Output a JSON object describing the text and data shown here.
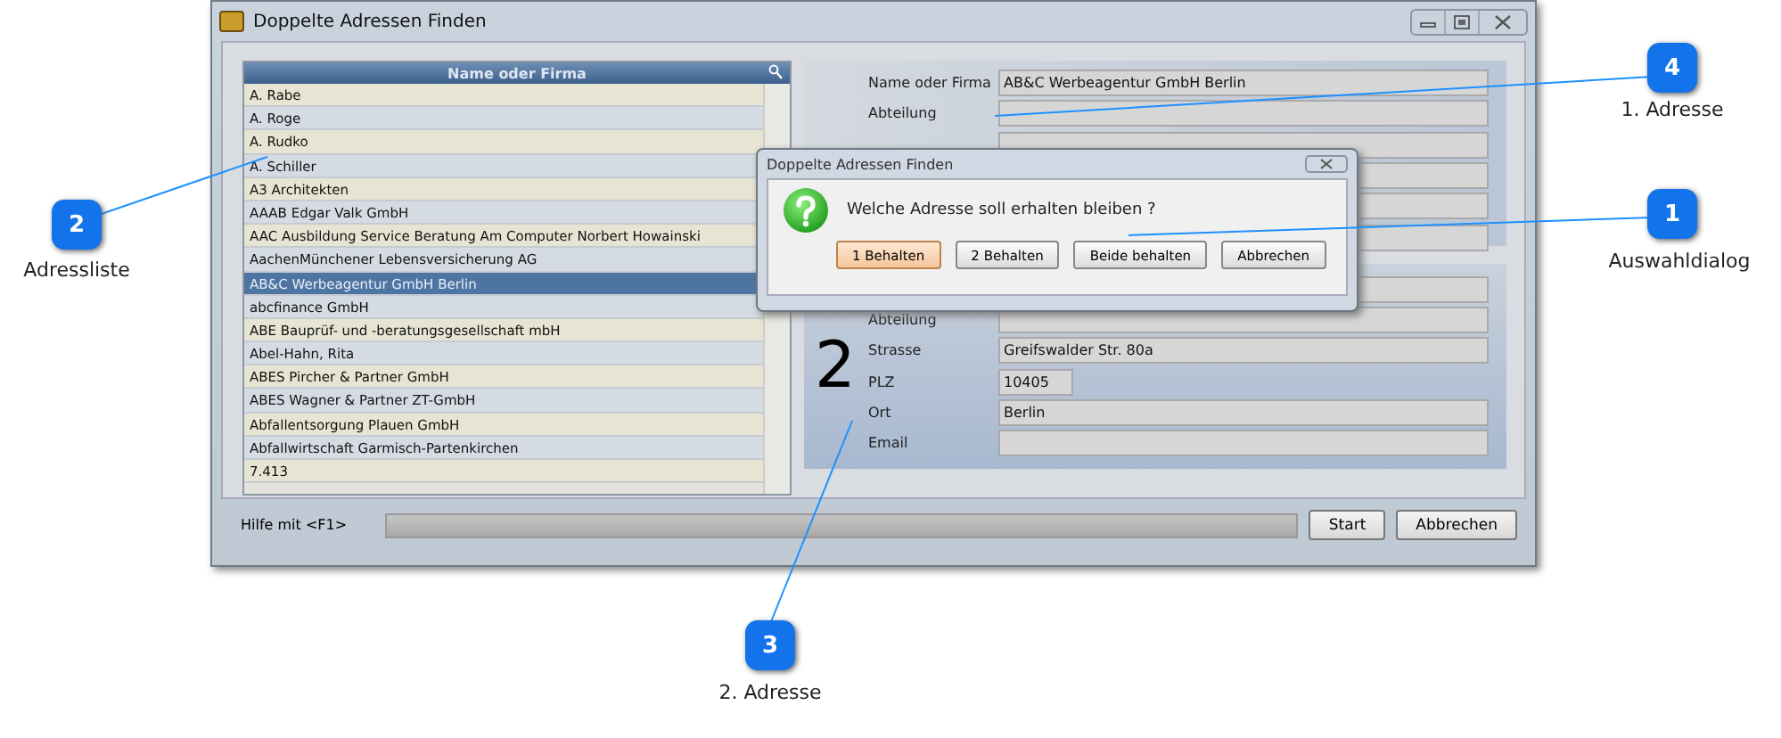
{
  "window": {
    "title": "Doppelte Adressen Finden"
  },
  "list": {
    "column": "Name oder Firma",
    "items": [
      {
        "label": "A. Rabe",
        "selected": false
      },
      {
        "label": "A. Roge",
        "selected": false
      },
      {
        "label": "A. Rudko",
        "selected": false
      },
      {
        "label": "A. Schiller",
        "selected": false
      },
      {
        "label": "A3 Architekten",
        "selected": false
      },
      {
        "label": "AAAB Edgar Valk GmbH",
        "selected": false
      },
      {
        "label": "AAC Ausbildung Service Beratung Am Computer Norbert Howainski",
        "selected": false
      },
      {
        "label": "AachenMünchener Lebensversicherung AG",
        "selected": false
      },
      {
        "label": "AB&C Werbeagentur GmbH Berlin",
        "selected": true
      },
      {
        "label": "abcfinance GmbH",
        "selected": false
      },
      {
        "label": "ABE Bauprüf- und -beratungsgesellschaft mbH",
        "selected": false
      },
      {
        "label": "Abel-Hahn, Rita",
        "selected": false
      },
      {
        "label": "ABES Pircher & Partner GmbH",
        "selected": false
      },
      {
        "label": "ABES Wagner & Partner ZT-GmbH",
        "selected": false
      },
      {
        "label": "Abfallentsorgung Plauen GmbH",
        "selected": false
      },
      {
        "label": "Abfallwirtschaft Garmisch-Partenkirchen",
        "selected": false
      }
    ],
    "count": "7.413"
  },
  "address_1": {
    "fields": [
      {
        "label": "Name oder Firma",
        "value": "AB&C Werbeagentur GmbH Berlin"
      },
      {
        "label": "Abteilung"
      }
    ]
  },
  "address_2": {
    "number": "2",
    "fields": [
      {
        "label": "Abteilung"
      },
      {
        "label": "Strasse",
        "value": "Greifswalder Str. 80a"
      },
      {
        "label": "PLZ",
        "value": "10405",
        "kind": "short"
      },
      {
        "label": "Ort",
        "value": "Berlin"
      },
      {
        "label": "Email"
      }
    ]
  },
  "status_bar": {
    "help": "Hilfe mit <F1>",
    "progress": {
      "level": 0
    },
    "buttons": [
      "Start",
      "Abbrechen"
    ]
  },
  "dialog": {
    "title": "Doppelte Adressen Finden",
    "question": "Welche Adresse soll erhalten bleiben ?",
    "buttons": [
      {
        "label": "1 Behalten",
        "selected": true
      },
      {
        "label": "2 Behalten",
        "selected": false
      },
      {
        "label": "Beide behalten",
        "selected": false
      },
      {
        "label": "Abbrechen",
        "selected": false
      }
    ]
  },
  "callouts": [
    {
      "number": "4",
      "label": "1. Adresse"
    },
    {
      "number": "2",
      "label": "Adressliste"
    },
    {
      "number": "1",
      "label": "Auswahldialog"
    },
    {
      "number": "3",
      "label": "2. Adresse"
    }
  ]
}
